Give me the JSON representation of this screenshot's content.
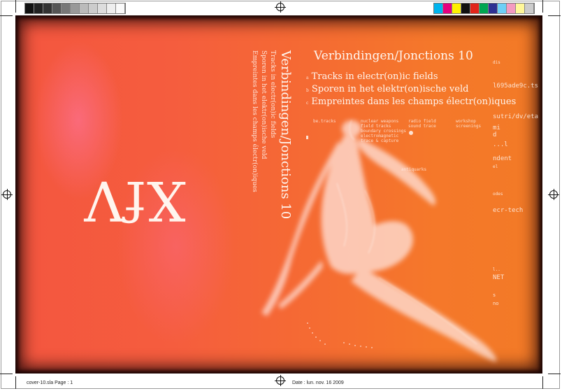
{
  "colors": {
    "accent_orange": "#f5782a",
    "accent_pink": "#f4563f"
  },
  "cover": {
    "logo": "XfV",
    "spine_title": "Verbindingen/Jonctions  10",
    "spine_lines": [
      "Tracks in electr(on)ic fields",
      "Sporen in het elektr(on)ische veld",
      "Empreintes dans les champs électr(on)iques"
    ],
    "front_title": "Verbindingen/Jonctions 10",
    "front_lines": [
      {
        "num": "a",
        "text": "Tracks in electr(on)ic fields"
      },
      {
        "num": "b",
        "text": "Sporen in het elektr(on)ische veld"
      },
      {
        "num": "c",
        "text": "Empreintes dans les champs électr(on)iques"
      }
    ],
    "right_column": [
      "dis",
      "l695ade9c.ts",
      "sutri/dv/eta",
      "mi",
      "d",
      "...l",
      "ndent",
      "el",
      "odes",
      "ecr-tech",
      "l..",
      "NET",
      "s",
      "no"
    ],
    "notes": [
      "be.tracks",
      "nuclear weapons\nfield tracks\nboundary crossings\nelectromagnetic\ntrace & capture",
      "radio field\nsound trace",
      "workshop\nscreenings",
      "antiquarks"
    ]
  },
  "footer": {
    "left": "cover-10.sla  Page : 1",
    "right": "Date : lun. nov. 16 2009"
  }
}
